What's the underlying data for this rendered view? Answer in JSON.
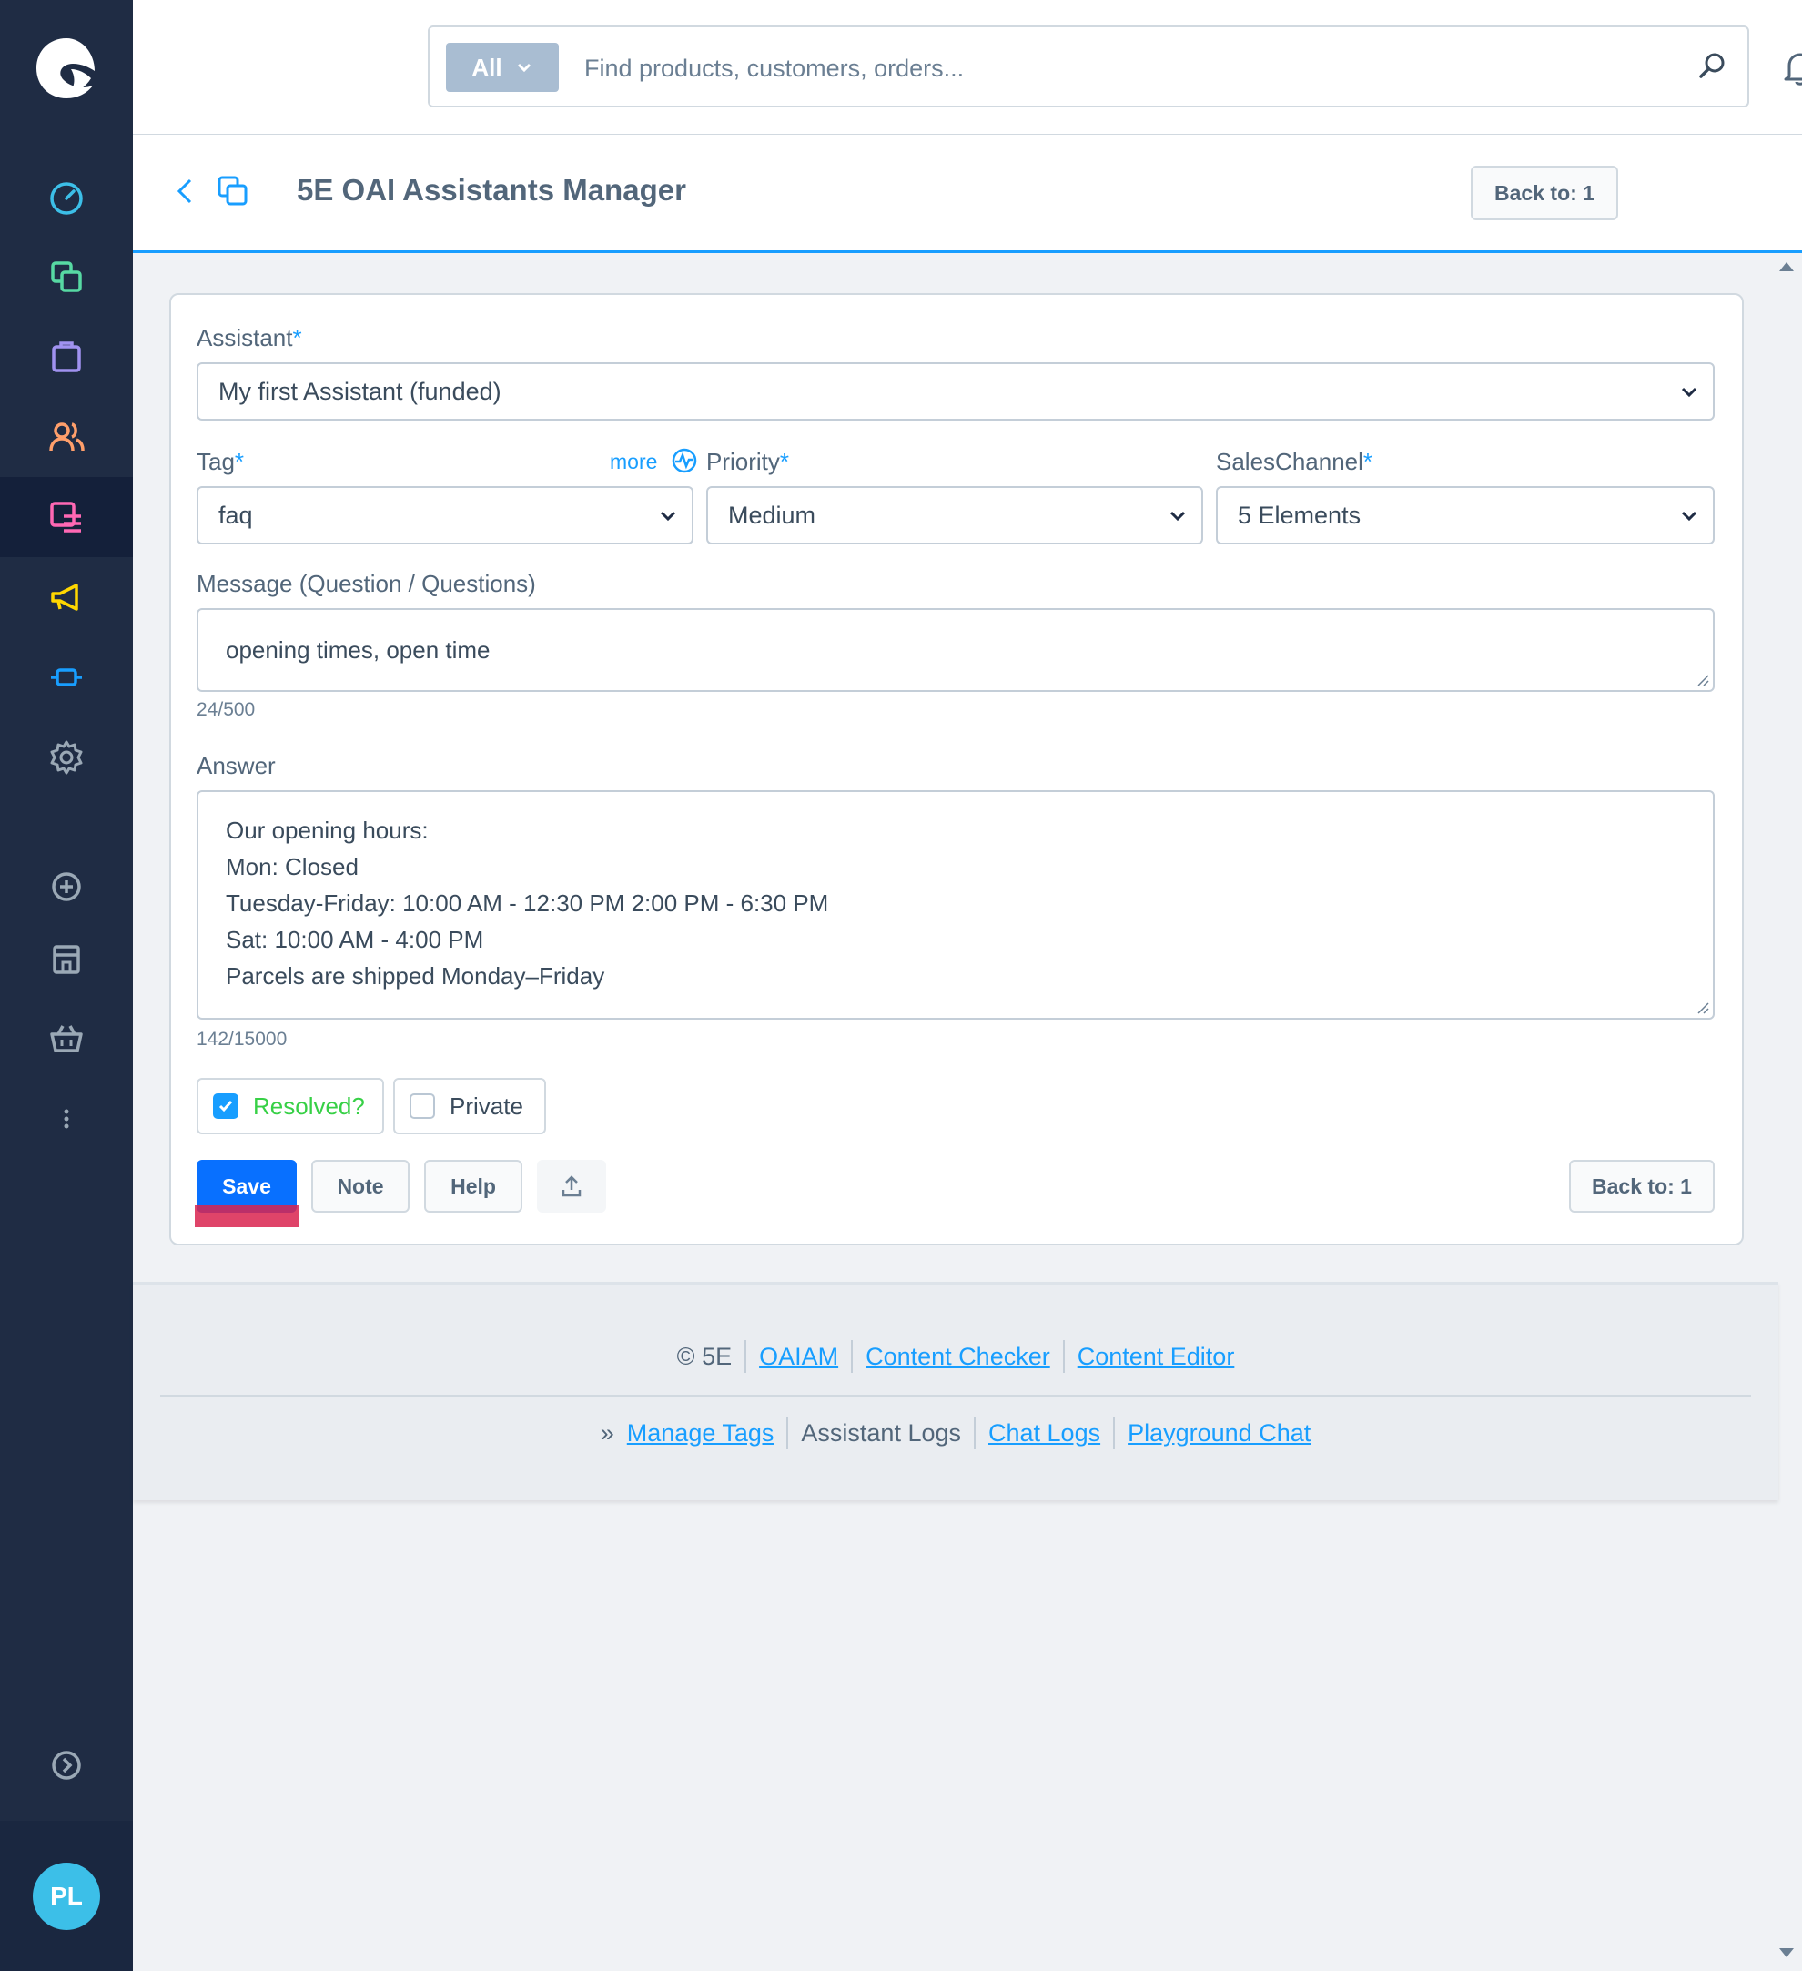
{
  "search": {
    "scope": "All",
    "placeholder": "Find products, customers, orders..."
  },
  "header": {
    "title": "5E OAI Assistants Manager",
    "back_button": "Back to: 1"
  },
  "sidebar": {
    "items": [
      {
        "icon": "dashboard-icon",
        "color": "#3cbfe8"
      },
      {
        "icon": "catalogue-icon",
        "color": "#57d9a3"
      },
      {
        "icon": "orders-icon",
        "color": "#a092f0"
      },
      {
        "icon": "customers-icon",
        "color": "#ff9f6b"
      },
      {
        "icon": "content-icon",
        "color": "#ff68b4"
      },
      {
        "icon": "marketing-icon",
        "color": "#ffd700"
      },
      {
        "icon": "extensions-icon",
        "color": "#189eff"
      },
      {
        "icon": "settings-icon",
        "color": "#9aa8b5"
      },
      {
        "icon": "add-icon",
        "color": "#9aa8b5"
      },
      {
        "icon": "store-icon",
        "color": "#9aa8b5"
      },
      {
        "icon": "basket-icon",
        "color": "#9aa8b5"
      },
      {
        "icon": "more-icon",
        "color": "#9aa8b5"
      },
      {
        "icon": "expand-icon",
        "color": "#9aa8b5"
      }
    ],
    "avatar": "PL"
  },
  "form": {
    "assistant": {
      "label": "Assistant",
      "required": "*",
      "value": "My first Assistant (funded)"
    },
    "tag": {
      "label": "Tag",
      "required": "*",
      "value": "faq",
      "more": "more"
    },
    "priority": {
      "label": "Priority",
      "required": "*",
      "value": "Medium"
    },
    "sales_channel": {
      "label": "SalesChannel",
      "required": "*",
      "value": "5 Elements"
    },
    "message": {
      "label": "Message (Question / Questions)",
      "value": "opening times, open time",
      "counter": "24/500"
    },
    "answer": {
      "label": "Answer",
      "lines": [
        "Our opening hours:",
        "Mon: Closed",
        "Tuesday-Friday: 10:00 AM - 12:30 PM 2:00 PM - 6:30 PM",
        "Sat: 10:00 AM - 4:00 PM",
        "Parcels are shipped Monday–Friday"
      ],
      "counter": "142/15000"
    },
    "resolved": {
      "label": "Resolved?",
      "checked": true
    },
    "private": {
      "label": "Private",
      "checked": false
    },
    "buttons": {
      "save": "Save",
      "note": "Note",
      "help": "Help",
      "back": "Back to: 1"
    }
  },
  "footer": {
    "row1": {
      "copyright": "© 5E",
      "links": [
        "OAIAM",
        "Content Checker",
        "Content Editor"
      ]
    },
    "row2": {
      "prefix": "»",
      "manage_tags": "Manage Tags",
      "assistant_logs": "Assistant Logs",
      "chat_logs": "Chat Logs",
      "playground_chat": "Playground Chat"
    }
  },
  "colors": {
    "accent": "#189eff",
    "primary_button": "#0870ff",
    "sidebar_bg": "#1f2c44",
    "resolved_text": "#37d046"
  }
}
